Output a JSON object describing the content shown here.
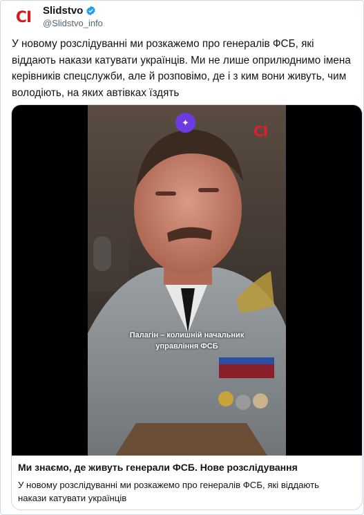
{
  "account": {
    "display_name": "Slidstvo",
    "handle": "@Slidstvo_info",
    "avatar_text": "CI"
  },
  "tweet": {
    "text": "У новому розслідуванні ми розкажемо про генералів ФСБ, які віддають накази катувати українців. Ми не лише оприлюднимо імена керівників спецслужби, але й розповімо, де і з ким вони живуть, чим володіють, на яких автівках їздять"
  },
  "card": {
    "watermark": "CI",
    "caption_line1": "Палагін – колишній начальник",
    "caption_line2": "управління ФСБ",
    "title": "Ми знаємо, де живуть генерали ФСБ. Нове розслідування",
    "description": "У новому розслідуванні ми розкажемо про генералів ФСБ, які віддають накази катувати українців"
  },
  "colors": {
    "brand_red": "#d31b24",
    "verified_blue": "#1d9bf0",
    "sparkle_purple": "#6e3be2"
  }
}
